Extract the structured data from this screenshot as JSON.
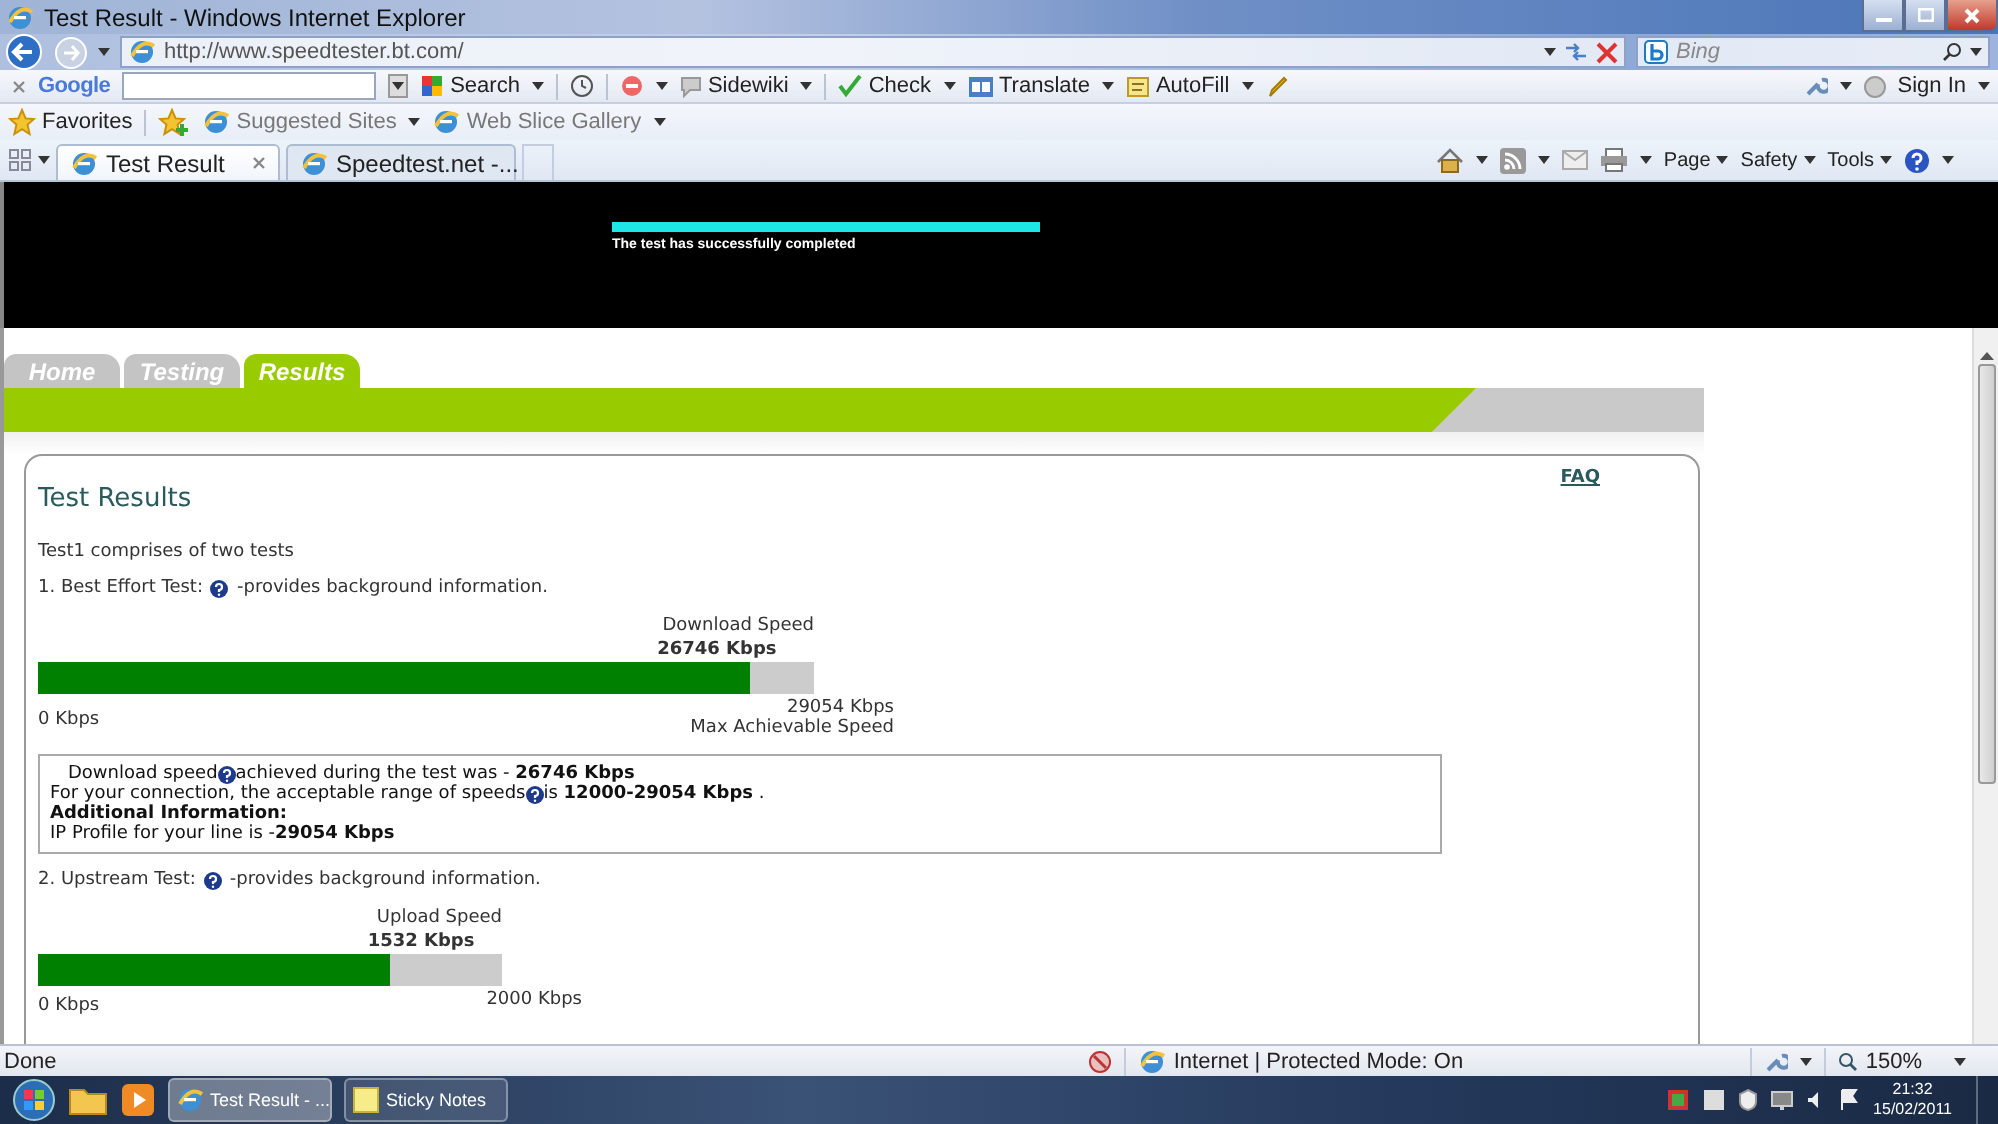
{
  "window": {
    "title": "Test Result - Windows Internet Explorer"
  },
  "address_bar": {
    "url": "http://www.speedtester.bt.com/",
    "search_placeholder": "Bing"
  },
  "google_toolbar": {
    "brand": "Google",
    "items": [
      "Search",
      "Sidewiki",
      "Check",
      "Translate",
      "AutoFill"
    ],
    "sign_in": "Sign In"
  },
  "favorites_bar": {
    "label": "Favorites",
    "links": [
      "Suggested Sites",
      "Web Slice Gallery"
    ]
  },
  "tabs": [
    {
      "label": "Test Result",
      "selected": true
    },
    {
      "label": "Speedtest.net -...",
      "selected": false
    }
  ],
  "command_bar": [
    "Page",
    "Safety",
    "Tools"
  ],
  "page": {
    "banner": {
      "status": "The test has successfully completed",
      "level": 1
    },
    "nav": [
      {
        "label": "Home",
        "selected": false
      },
      {
        "label": "Testing",
        "selected": false
      },
      {
        "label": "Results",
        "selected": true
      }
    ],
    "title": "Test Results",
    "faq": "FAQ",
    "intro": "Test1 comprises of two tests",
    "tests": [
      {
        "heading": "1. Best Effort Test:",
        "note": "-provides background information.",
        "meter_label": "Download Speed",
        "reading": "26746 Kbps",
        "level": 0.918,
        "min": "0 Kbps",
        "max": "29054 Kbps",
        "max_label": "Max Achievable Speed",
        "info": [
          {
            "kind": "help",
            "before": "Download speed",
            "after": "achieved during the test was - **26746 Kbps**"
          },
          {
            "kind": "help",
            "before": "For your connection, the acceptable range of speeds",
            "after": "is **12000-29054 Kbps** ."
          },
          {
            "kind": "heading",
            "text": "Additional Information:"
          },
          {
            "kind": "plain",
            "text": "IP Profile for your line is -**29054 Kbps**"
          }
        ]
      },
      {
        "heading": "2. Upstream Test:",
        "note": "-provides background information.",
        "meter_label": "Upload Speed",
        "reading": "1532 Kbps",
        "level": 0.76,
        "min": "0 Kbps",
        "max": "2000 Kbps"
      }
    ]
  },
  "status_bar": {
    "status": "Done",
    "zone": "Internet | Protected Mode: On",
    "zoom": "150%"
  },
  "taskbar": {
    "items": [
      {
        "label": "Test Result - ...",
        "selected": true
      },
      {
        "label": "Sticky Notes",
        "selected": false
      }
    ],
    "time": "21:32",
    "date": "15/02/2011"
  }
}
